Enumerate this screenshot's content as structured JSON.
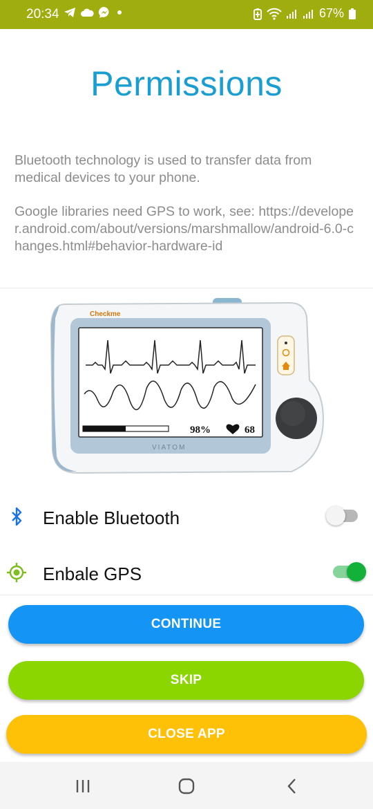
{
  "status_bar": {
    "time": "20:34",
    "battery": "67%",
    "background": "#a0ad0e",
    "left_icons": [
      "telegram-icon",
      "cloud-icon",
      "messenger-icon",
      "dot-icon"
    ],
    "right_icons": [
      "battery-saver-icon",
      "wifi-icon",
      "signal-icon",
      "signal-icon",
      "battery-icon"
    ]
  },
  "title": "Permissions",
  "bluetooth_text": "Bluetooth technology is used to transfer data from medical devices to your phone.",
  "gps_text": "Google libraries need GPS to work, see: https://developer.android.com/about/versions/marshmallow/android-6.0-changes.html#behavior-hardware-id",
  "device": {
    "brand": "Checkme",
    "maker": "VIATOM",
    "spo2": "98%",
    "heart_rate": "68",
    "battery_level": 0.5
  },
  "permissions": [
    {
      "label": "Enable Bluetooth",
      "icon": "bluetooth-icon",
      "enabled": false
    },
    {
      "label": "Enbale GPS",
      "icon": "gps-icon",
      "enabled": true
    }
  ],
  "buttons": {
    "continue": "CONTINUE",
    "skip": "SKIP",
    "close": "CLOSE APP"
  },
  "colors": {
    "title": "#1a9ed1",
    "continue": "#1494f5",
    "skip": "#8bd600",
    "close": "#ffc107",
    "toggle_on": "#13b03a"
  },
  "nav": [
    "recent-apps-icon",
    "home-icon",
    "back-icon"
  ]
}
